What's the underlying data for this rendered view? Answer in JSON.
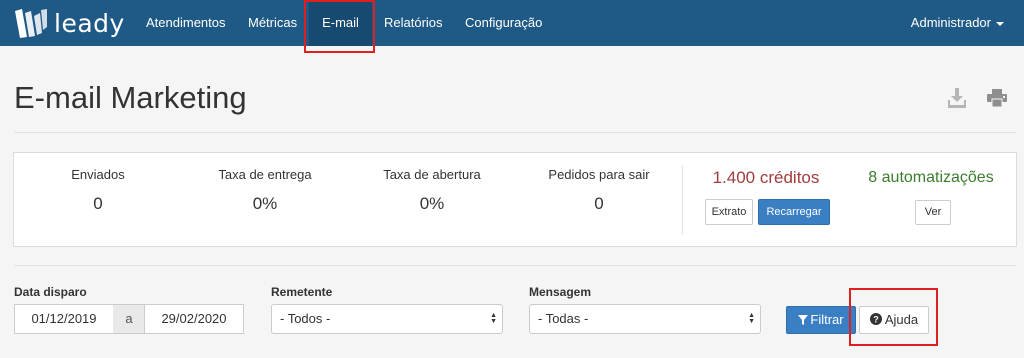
{
  "brand": {
    "name": "leady"
  },
  "nav": {
    "items": [
      {
        "label": "Atendimentos"
      },
      {
        "label": "Métricas"
      },
      {
        "label": "E-mail"
      },
      {
        "label": "Relatórios"
      },
      {
        "label": "Configuração"
      }
    ],
    "active_item": "E-mail",
    "user_menu": "Administrador"
  },
  "page": {
    "title": "E-mail Marketing"
  },
  "toolbar": {
    "icons": [
      "download-icon",
      "print-icon"
    ]
  },
  "stats": [
    {
      "label": "Enviados",
      "value": "0"
    },
    {
      "label": "Taxa de entrega",
      "value": "0%"
    },
    {
      "label": "Taxa de abertura",
      "value": "0%"
    },
    {
      "label": "Pedidos para sair",
      "value": "0"
    }
  ],
  "credits": {
    "text": "1.400 créditos",
    "extrato_label": "Extrato",
    "recarregar_label": "Recarregar"
  },
  "automations": {
    "text": "8 automatizações",
    "ver_label": "Ver"
  },
  "filters": {
    "date_label": "Data disparo",
    "date_from": "01/12/2019",
    "date_sep": "a",
    "date_to": "29/02/2020",
    "sender_label": "Remetente",
    "sender_value": "- Todos -",
    "message_label": "Mensagem",
    "message_value": "- Todas -",
    "filter_label": "Filtrar",
    "help_label": "Ajuda"
  },
  "colors": {
    "navbar": "#1f5a86",
    "primary": "#3a7fc4",
    "credits": "#a33c3c",
    "automations": "#3c7d2e",
    "highlight": "#e02020"
  }
}
